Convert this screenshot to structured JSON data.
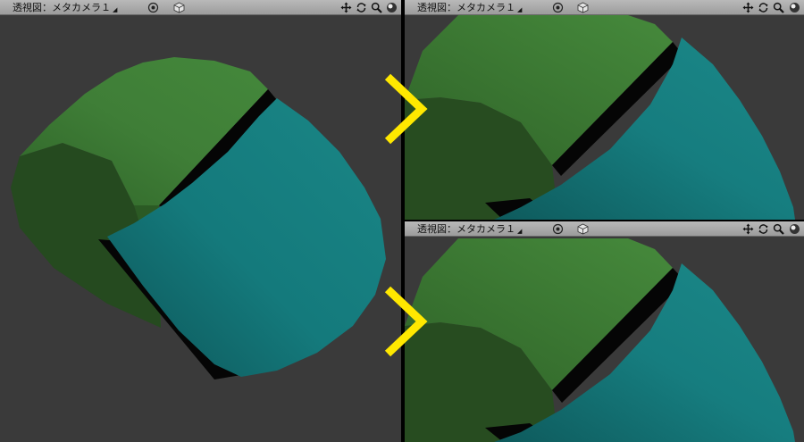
{
  "viewports": {
    "main": {
      "title": "透視図：メタカメラ１"
    },
    "top": {
      "title": "透視図：メタカメラ１"
    },
    "bottom": {
      "title": "透視図：メタカメラ１"
    }
  },
  "icons": [
    "target-icon",
    "cube-icon",
    "pan-icon",
    "rotate-icon",
    "zoom-icon",
    "sphere-icon"
  ],
  "colors": {
    "viewport_bg": "#3a3a3a",
    "green_cylinder": "#3f7a35",
    "teal_cylinder": "#177f80",
    "arrow": "#ffe800"
  }
}
